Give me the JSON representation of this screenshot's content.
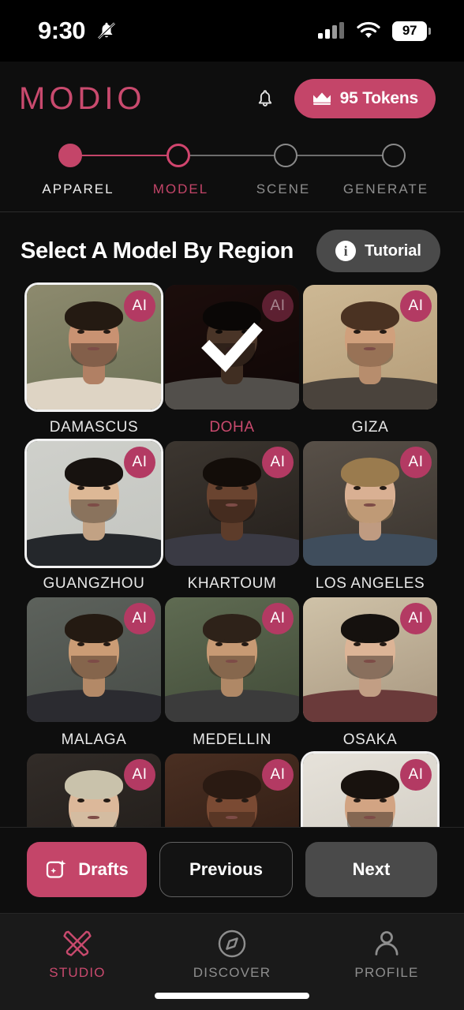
{
  "statusbar": {
    "time": "9:30",
    "silent_icon": "bell-slash-icon",
    "cellular_icon": "cellular-signal-icon",
    "wifi_icon": "wifi-icon",
    "battery_percent": "97"
  },
  "header": {
    "logo": "MODIO",
    "notification_icon": "bell-icon",
    "tokens": {
      "icon": "crown-icon",
      "label": "95 Tokens"
    }
  },
  "stepper": {
    "steps": [
      {
        "label": "APPAREL",
        "state": "done"
      },
      {
        "label": "MODEL",
        "state": "active"
      },
      {
        "label": "SCENE",
        "state": "upcoming"
      },
      {
        "label": "GENERATE",
        "state": "upcoming"
      }
    ]
  },
  "main": {
    "title": "Select A Model By Region",
    "tutorial": {
      "icon": "info-icon",
      "label": "Tutorial"
    },
    "badge_text": "AI",
    "models": [
      {
        "label": "DAMASCUS",
        "selected": false,
        "highlighted": true,
        "skin": "#c99272",
        "hair": "#241a12",
        "bg1": "#8d8a6e",
        "bg2": "#6d7257",
        "cloth": "#ded4c4"
      },
      {
        "label": "DOHA",
        "selected": true,
        "highlighted": false,
        "skin": "#c08a66",
        "hair": "#1c1410",
        "bg1": "#4a2420",
        "bg2": "#2a1412",
        "cloth": "#d8d0c4"
      },
      {
        "label": "GIZA",
        "selected": false,
        "highlighted": false,
        "skin": "#d0a07c",
        "hair": "#4a3222",
        "bg1": "#cdb894",
        "bg2": "#b49c78",
        "cloth": "#4a433c"
      },
      {
        "label": "GUANGZHOU",
        "selected": false,
        "highlighted": true,
        "skin": "#ddb896",
        "hair": "#17120f",
        "bg1": "#cfd0cb",
        "bg2": "#c3c5c0",
        "cloth": "#24272b"
      },
      {
        "label": "KHARTOUM",
        "selected": false,
        "highlighted": false,
        "skin": "#6a4430",
        "hair": "#130d09",
        "bg1": "#3c3630",
        "bg2": "#241f1b",
        "cloth": "#3a3a44"
      },
      {
        "label": "LOS ANGELES",
        "selected": false,
        "highlighted": false,
        "skin": "#d9b093",
        "hair": "#9a7b4e",
        "bg1": "#585048",
        "bg2": "#3a342e",
        "cloth": "#3f4d5c"
      },
      {
        "label": "MALAGA",
        "selected": false,
        "highlighted": false,
        "skin": "#cb9c75",
        "hair": "#241a12",
        "bg1": "#5d625c",
        "bg2": "#474c47",
        "cloth": "#2b2b30"
      },
      {
        "label": "MEDELLIN",
        "selected": false,
        "highlighted": false,
        "skin": "#c79a74",
        "hair": "#2e2219",
        "bg1": "#5f6b52",
        "bg2": "#414b38",
        "cloth": "#3b3b3b"
      },
      {
        "label": "OSAKA",
        "selected": false,
        "highlighted": false,
        "skin": "#dcb496",
        "hair": "#15110e",
        "bg1": "#cfc2a8",
        "bg2": "#a89780",
        "cloth": "#6a3a3a"
      }
    ],
    "partial_row": [
      {
        "skin": "#dcb89a",
        "hair": "#c9c2ab",
        "bg1": "#322c28",
        "bg2": "#1f1b18",
        "highlighted": false
      },
      {
        "skin": "#7a4a33",
        "hair": "#2a1a12",
        "bg1": "#4a2f22",
        "bg2": "#2c1a12",
        "highlighted": false
      },
      {
        "skin": "#d2a483",
        "hair": "#18120e",
        "bg1": "#e6e2da",
        "bg2": "#cfcac0",
        "highlighted": true
      }
    ]
  },
  "actions": {
    "drafts": {
      "icon": "sparkle-square-icon",
      "label": "Drafts"
    },
    "previous": "Previous",
    "next": "Next"
  },
  "tabbar": {
    "tabs": [
      {
        "label": "STUDIO",
        "icon": "brush-pencil-icon",
        "active": true
      },
      {
        "label": "DISCOVER",
        "icon": "compass-icon",
        "active": false
      },
      {
        "label": "PROFILE",
        "icon": "person-icon",
        "active": false
      }
    ]
  },
  "colors": {
    "accent": "#C44569",
    "accent_text": "#C94A6E",
    "bg": "#0e0e0e",
    "surface": "#1a1a1a"
  }
}
